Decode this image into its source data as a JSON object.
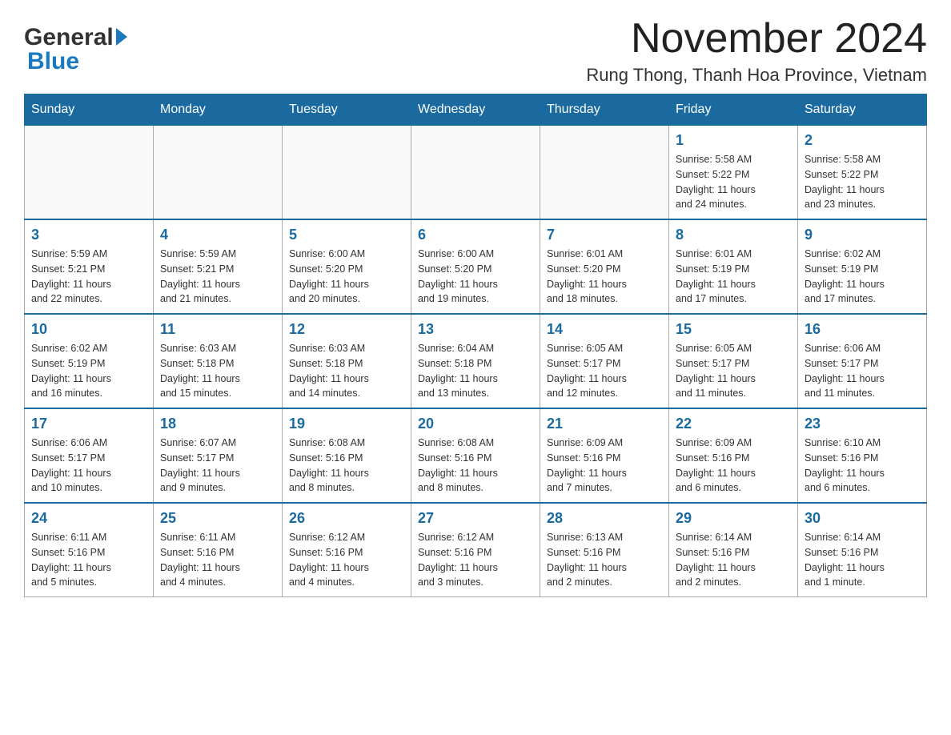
{
  "logo": {
    "general": "General",
    "blue": "Blue",
    "arrow": "▶"
  },
  "title": "November 2024",
  "subtitle": "Rung Thong, Thanh Hoa Province, Vietnam",
  "days_of_week": [
    "Sunday",
    "Monday",
    "Tuesday",
    "Wednesday",
    "Thursday",
    "Friday",
    "Saturday"
  ],
  "weeks": [
    [
      {
        "day": "",
        "info": ""
      },
      {
        "day": "",
        "info": ""
      },
      {
        "day": "",
        "info": ""
      },
      {
        "day": "",
        "info": ""
      },
      {
        "day": "",
        "info": ""
      },
      {
        "day": "1",
        "info": "Sunrise: 5:58 AM\nSunset: 5:22 PM\nDaylight: 11 hours\nand 24 minutes."
      },
      {
        "day": "2",
        "info": "Sunrise: 5:58 AM\nSunset: 5:22 PM\nDaylight: 11 hours\nand 23 minutes."
      }
    ],
    [
      {
        "day": "3",
        "info": "Sunrise: 5:59 AM\nSunset: 5:21 PM\nDaylight: 11 hours\nand 22 minutes."
      },
      {
        "day": "4",
        "info": "Sunrise: 5:59 AM\nSunset: 5:21 PM\nDaylight: 11 hours\nand 21 minutes."
      },
      {
        "day": "5",
        "info": "Sunrise: 6:00 AM\nSunset: 5:20 PM\nDaylight: 11 hours\nand 20 minutes."
      },
      {
        "day": "6",
        "info": "Sunrise: 6:00 AM\nSunset: 5:20 PM\nDaylight: 11 hours\nand 19 minutes."
      },
      {
        "day": "7",
        "info": "Sunrise: 6:01 AM\nSunset: 5:20 PM\nDaylight: 11 hours\nand 18 minutes."
      },
      {
        "day": "8",
        "info": "Sunrise: 6:01 AM\nSunset: 5:19 PM\nDaylight: 11 hours\nand 17 minutes."
      },
      {
        "day": "9",
        "info": "Sunrise: 6:02 AM\nSunset: 5:19 PM\nDaylight: 11 hours\nand 17 minutes."
      }
    ],
    [
      {
        "day": "10",
        "info": "Sunrise: 6:02 AM\nSunset: 5:19 PM\nDaylight: 11 hours\nand 16 minutes."
      },
      {
        "day": "11",
        "info": "Sunrise: 6:03 AM\nSunset: 5:18 PM\nDaylight: 11 hours\nand 15 minutes."
      },
      {
        "day": "12",
        "info": "Sunrise: 6:03 AM\nSunset: 5:18 PM\nDaylight: 11 hours\nand 14 minutes."
      },
      {
        "day": "13",
        "info": "Sunrise: 6:04 AM\nSunset: 5:18 PM\nDaylight: 11 hours\nand 13 minutes."
      },
      {
        "day": "14",
        "info": "Sunrise: 6:05 AM\nSunset: 5:17 PM\nDaylight: 11 hours\nand 12 minutes."
      },
      {
        "day": "15",
        "info": "Sunrise: 6:05 AM\nSunset: 5:17 PM\nDaylight: 11 hours\nand 11 minutes."
      },
      {
        "day": "16",
        "info": "Sunrise: 6:06 AM\nSunset: 5:17 PM\nDaylight: 11 hours\nand 11 minutes."
      }
    ],
    [
      {
        "day": "17",
        "info": "Sunrise: 6:06 AM\nSunset: 5:17 PM\nDaylight: 11 hours\nand 10 minutes."
      },
      {
        "day": "18",
        "info": "Sunrise: 6:07 AM\nSunset: 5:17 PM\nDaylight: 11 hours\nand 9 minutes."
      },
      {
        "day": "19",
        "info": "Sunrise: 6:08 AM\nSunset: 5:16 PM\nDaylight: 11 hours\nand 8 minutes."
      },
      {
        "day": "20",
        "info": "Sunrise: 6:08 AM\nSunset: 5:16 PM\nDaylight: 11 hours\nand 8 minutes."
      },
      {
        "day": "21",
        "info": "Sunrise: 6:09 AM\nSunset: 5:16 PM\nDaylight: 11 hours\nand 7 minutes."
      },
      {
        "day": "22",
        "info": "Sunrise: 6:09 AM\nSunset: 5:16 PM\nDaylight: 11 hours\nand 6 minutes."
      },
      {
        "day": "23",
        "info": "Sunrise: 6:10 AM\nSunset: 5:16 PM\nDaylight: 11 hours\nand 6 minutes."
      }
    ],
    [
      {
        "day": "24",
        "info": "Sunrise: 6:11 AM\nSunset: 5:16 PM\nDaylight: 11 hours\nand 5 minutes."
      },
      {
        "day": "25",
        "info": "Sunrise: 6:11 AM\nSunset: 5:16 PM\nDaylight: 11 hours\nand 4 minutes."
      },
      {
        "day": "26",
        "info": "Sunrise: 6:12 AM\nSunset: 5:16 PM\nDaylight: 11 hours\nand 4 minutes."
      },
      {
        "day": "27",
        "info": "Sunrise: 6:12 AM\nSunset: 5:16 PM\nDaylight: 11 hours\nand 3 minutes."
      },
      {
        "day": "28",
        "info": "Sunrise: 6:13 AM\nSunset: 5:16 PM\nDaylight: 11 hours\nand 2 minutes."
      },
      {
        "day": "29",
        "info": "Sunrise: 6:14 AM\nSunset: 5:16 PM\nDaylight: 11 hours\nand 2 minutes."
      },
      {
        "day": "30",
        "info": "Sunrise: 6:14 AM\nSunset: 5:16 PM\nDaylight: 11 hours\nand 1 minute."
      }
    ]
  ]
}
